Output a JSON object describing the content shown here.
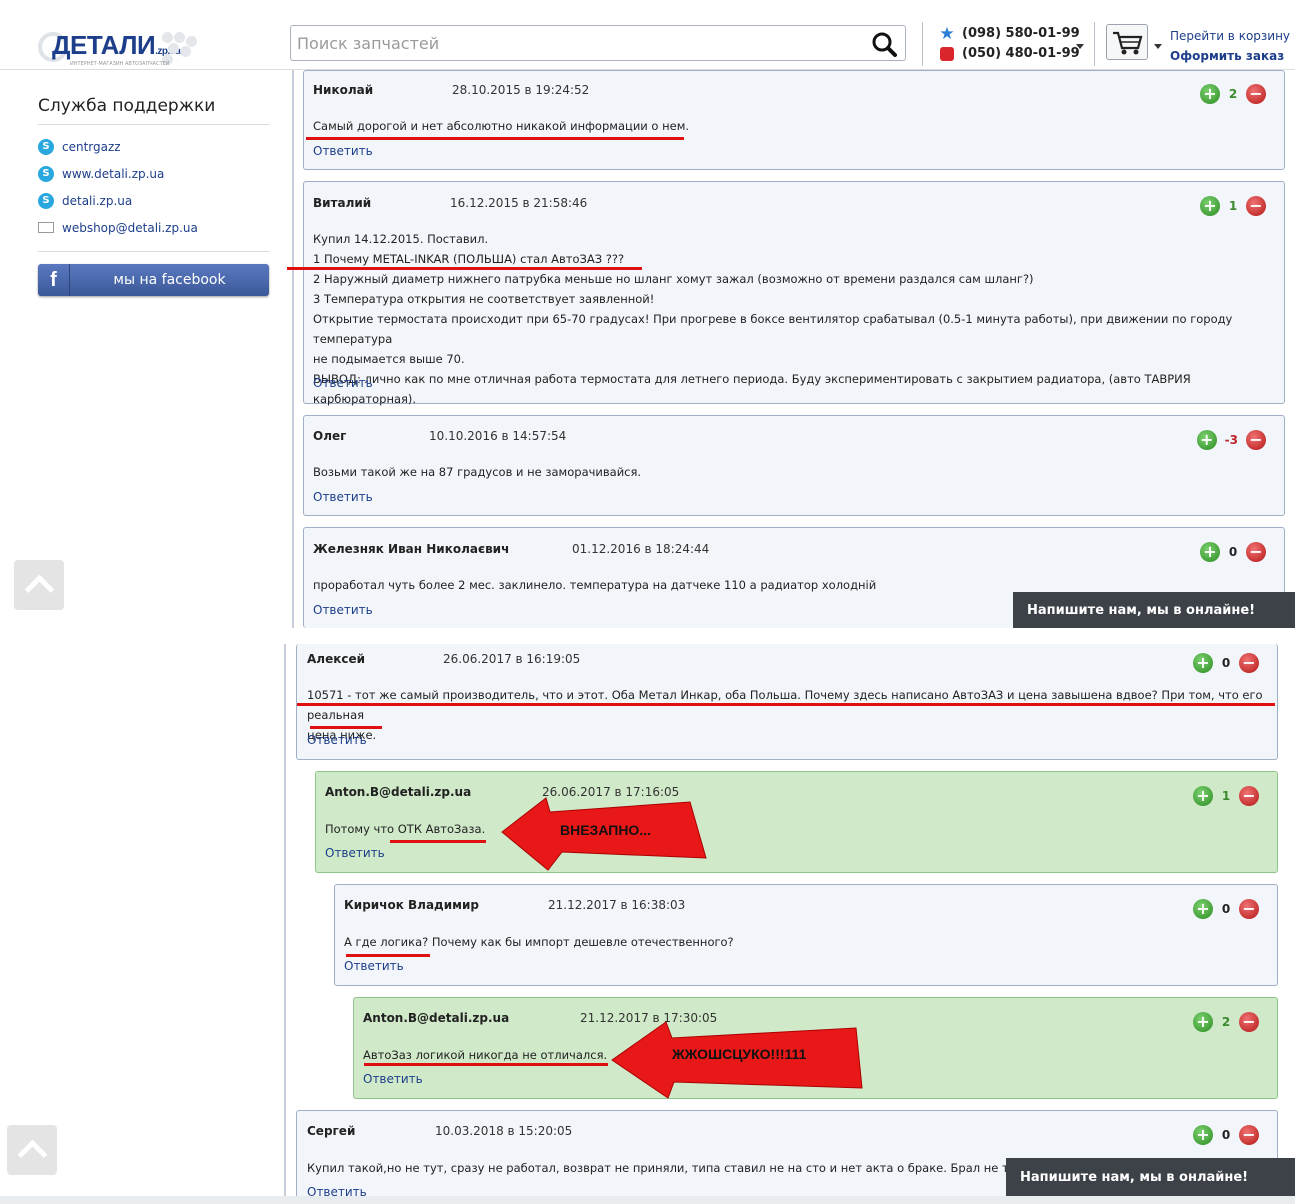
{
  "header": {
    "logo": {
      "brand": "ДЕТАЛИ",
      "domain": ".zp.ua",
      "tagline": "ИНТЕРНЕТ-МАГАЗИН АВТОЗАПЧАСТЕЙ"
    },
    "search": {
      "placeholder": "Поиск запчастей"
    },
    "phones": [
      "(098) 580-01-99",
      "(050) 480-01-99"
    ],
    "cart": {
      "link": "Перейти в корзину",
      "checkout": "Оформить заказ"
    }
  },
  "sidebar": {
    "title": "Служба поддержки",
    "contacts": [
      {
        "icon": "skype-icon",
        "label": "centrgazz"
      },
      {
        "icon": "skype-icon",
        "label": "www.detali.zp.ua"
      },
      {
        "icon": "skype-icon",
        "label": "detali.zp.ua"
      },
      {
        "icon": "mail-icon",
        "label": "webshop@detali.zp.ua"
      }
    ],
    "facebook": {
      "icon": "f",
      "label": "мы на facebook"
    }
  },
  "comments": [
    {
      "author": "Николай",
      "date": "28.10.2015 в 19:24:52",
      "votes": "2",
      "text": [
        "Самый дорогой и нет абсолютно никакой информации о нем."
      ],
      "reply": "Ответить"
    },
    {
      "author": "Виталий",
      "date": "16.12.2015 в 21:58:46",
      "votes": "1",
      "text": [
        "Купил 14.12.2015. Поставил.",
        "1 Почему METAL-INKAR (ПОЛЬША) стал АвтоЗАЗ ???",
        "2 Наружный диаметр нижнего патрубка меньше но шланг хомут зажал (возможно от времени раздался сам шланг?)",
        "3 Температура открытия не соответствует заявленной!",
        "Открытие термостата происходит при 65-70 градусах! При прогреве в боксе вентилятор срабатывал (0.5-1 минута работы), при движении по городу температура",
        "не подымается выше 70.",
        "ВЫВОД: лично как по мне отличная работа термостата для летнего периода. Буду экспериментировать с закрытием радиатора, (авто ТАВРИЯ карбюраторная)."
      ],
      "reply": "Ответить"
    },
    {
      "author": "Олег",
      "date": "10.10.2016 в 14:57:54",
      "votes": "-3",
      "text": [
        "Возьми такой же на 87 градусов и не заморачивайся."
      ],
      "reply": "Ответить"
    },
    {
      "author": "Железняк Иван Николаєвич",
      "date": "01.12.2016 в 18:24:44",
      "votes": "0",
      "text": [
        "проработал чуть более 2 мес. заклинело. температура на датчеке 110 а радиатор холодній"
      ],
      "reply": "Ответить"
    },
    {
      "author": "Алексей",
      "date": "26.06.2017 в 16:19:05",
      "votes": "0",
      "text": [
        "10571 - тот же самый производитель, что и этот. Оба Метал Инкар, оба Польша. Почему здесь написано АвтоЗАЗ и цена завышена вдвое? При том, что его реальная",
        "цена ниже."
      ],
      "reply": "Ответить"
    },
    {
      "author": "Anton.B@detali.zp.ua",
      "date": "26.06.2017 в 17:16:05",
      "votes": "1",
      "text": [
        "Потому что ОТК АвтоЗаза."
      ],
      "reply": "Ответить"
    },
    {
      "author": "Киричок Владимир",
      "date": "21.12.2017 в 16:38:03",
      "votes": "0",
      "text": [
        "А где логика? Почему как бы импорт дешевле отечественного?"
      ],
      "reply": "Ответить"
    },
    {
      "author": "Anton.B@detali.zp.ua",
      "date": "21.12.2017 в 17:30:05",
      "votes": "2",
      "text": [
        "АвтоЗаз логикой никогда не отличался."
      ],
      "reply": "Ответить"
    },
    {
      "author": "Сергей",
      "date": "10.03.2018 в 15:20:05",
      "votes": "0",
      "text": [
        "Купил такой,но не тут, сразу не работал, возврат не приняли, типа ставил не на сто и нет акта о браке. Брал не тут."
      ],
      "reply": "Ответить"
    }
  ],
  "annotations": {
    "arrow1": "ВНЕЗАПНО...",
    "arrow2": "ЖЖОШСЦУКО!!!111"
  },
  "chat": {
    "label": "Напишите нам, мы в онлайне!"
  },
  "colors": {
    "brand": "#1d3e8a",
    "annotation": "#e01010",
    "comment_bg": "#f2f5f9",
    "staff_bg": "#cfe9c9"
  }
}
